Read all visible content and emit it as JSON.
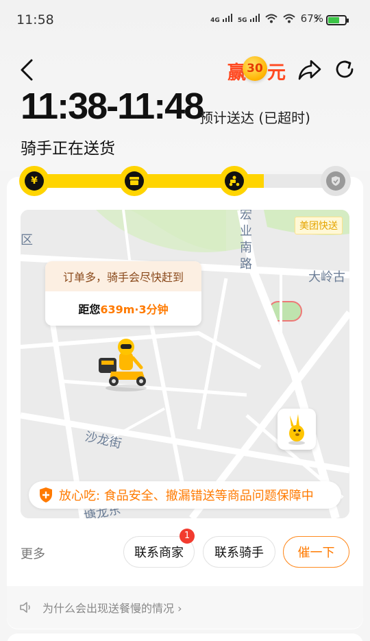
{
  "status_bar": {
    "time": "11:58",
    "network_1": "4G",
    "network_2": "5G",
    "battery_percent": "67%",
    "battery_level": 0.67,
    "battery_color": "#3cc447"
  },
  "header": {
    "promo": {
      "prefix": "赢",
      "amount": "30",
      "suffix": "元"
    },
    "icons": [
      "back-arrow-icon",
      "share-icon",
      "refresh-icon"
    ]
  },
  "delivery": {
    "eta": "11:38-11:48",
    "eta_note": "预计送达 (已超时)",
    "status": "骑手正在送货"
  },
  "progress": {
    "fraction": 0.74,
    "accent": "#ffd400",
    "steps": [
      {
        "icon": "yuan-icon",
        "glyph": "¥"
      },
      {
        "icon": "shop-icon",
        "glyph": ""
      },
      {
        "icon": "rider-icon",
        "glyph": ""
      },
      {
        "icon": "check-shield-icon",
        "glyph": ""
      }
    ]
  },
  "map": {
    "brand_badge": "美团快送",
    "place_labels": {
      "district": "区",
      "road_vertical": [
        "宏",
        "业",
        "南",
        "路"
      ],
      "road_east": "大岭古",
      "street": "沙龙街",
      "street_bottom": "塘龙东"
    },
    "bubble": {
      "top": "订单多，骑手会尽快赶到",
      "distance_prefix": "距您",
      "distance_value": "639m·3分钟"
    },
    "guarantee": "放心吃: 食品安全、撤漏错送等商品问题保障中"
  },
  "actions": {
    "more": "更多",
    "contact_merchant": "联系商家",
    "merchant_badge": "1",
    "contact_rider": "联系骑手",
    "urge": "催一下"
  },
  "tip": {
    "text": "为什么会出现送餐慢的情况 ›"
  }
}
